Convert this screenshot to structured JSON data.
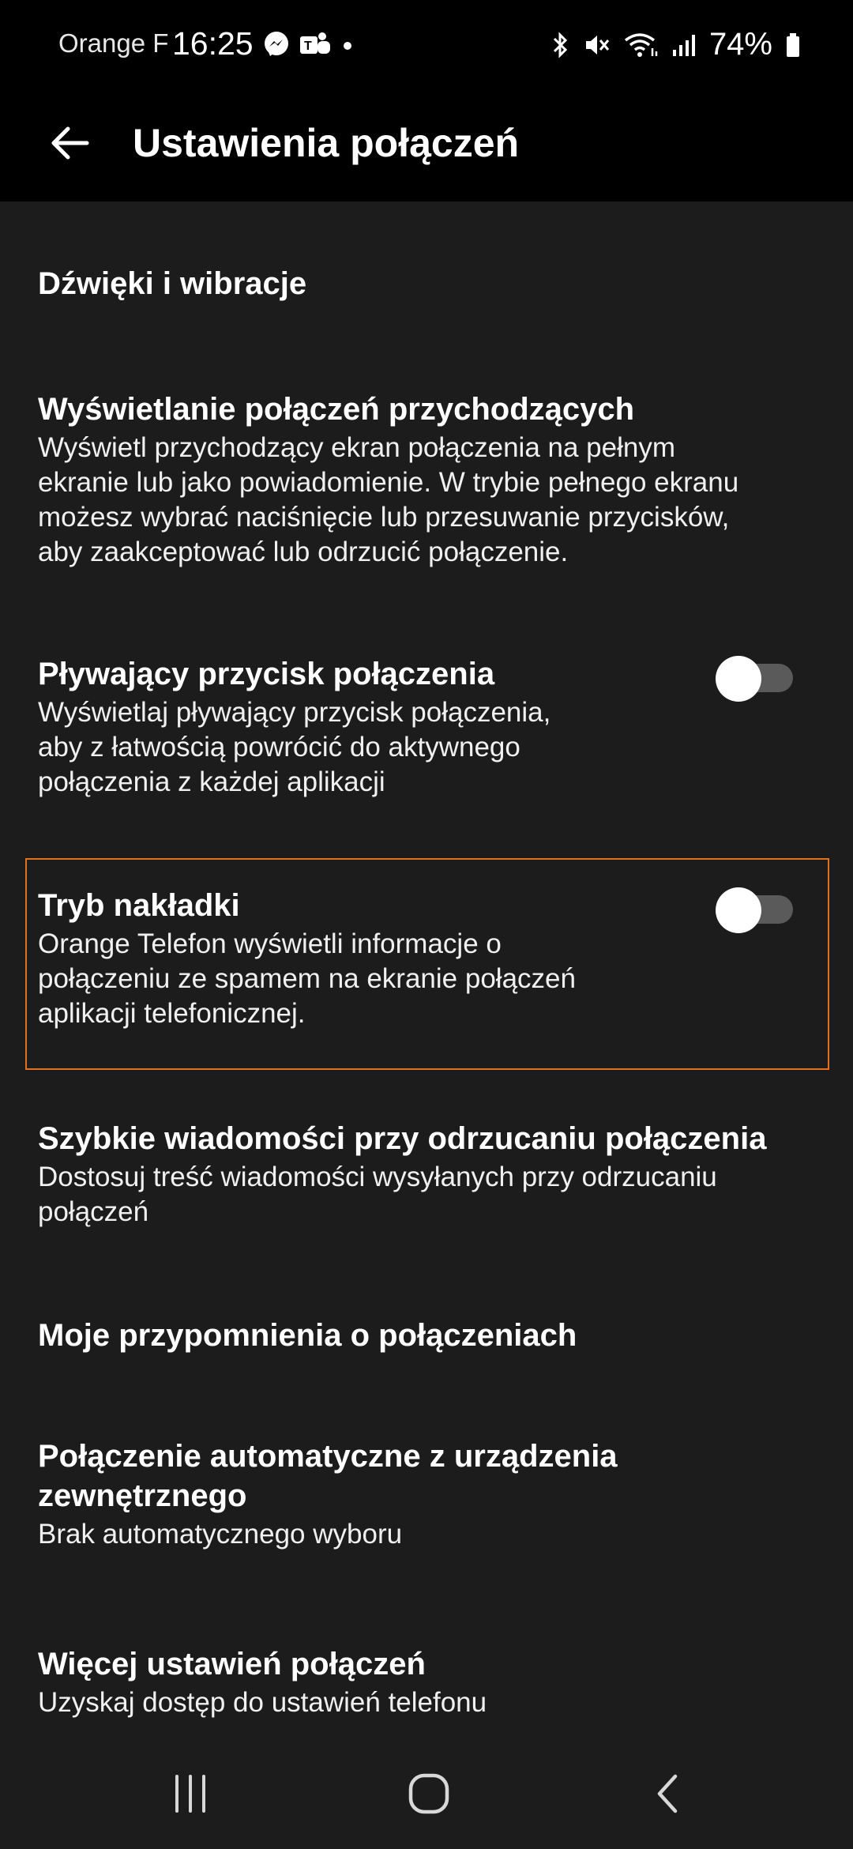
{
  "status_bar": {
    "carrier": "Orange F",
    "time": "16:25",
    "left_icons": [
      "messenger-icon",
      "teams-icon",
      "dot-icon"
    ],
    "right_icons": [
      "bluetooth-icon",
      "mute-icon",
      "wifi-icon",
      "signal-icon",
      "battery-icon"
    ],
    "battery": "74%"
  },
  "app_bar": {
    "title": "Ustawienia połączeń",
    "back_icon": "arrow-left-icon"
  },
  "settings": [
    {
      "title": "Dźwięki i wibracje"
    },
    {
      "title": "Wyświetlanie połączeń przychodzących",
      "desc": [
        "Wyświetl przychodzący ekran połączenia na pełnym",
        "ekranie lub jako powiadomienie. W trybie pełnego ekranu",
        "możesz wybrać naciśnięcie lub przesuwanie przycisków,",
        "aby zaakceptować lub odrzucić połączenie."
      ]
    },
    {
      "title": "Pływający przycisk połączenia",
      "desc": [
        "Wyświetlaj pływający przycisk połączenia,",
        "aby z łatwością powrócić do aktywnego",
        "połączenia z każdej aplikacji"
      ],
      "toggle": "off"
    },
    {
      "title": "Tryb nakładki",
      "desc": [
        "Orange Telefon wyświetli informacje o",
        "połączeniu ze spamem na ekranie połączeń",
        "aplikacji telefonicznej."
      ],
      "toggle": "off"
    },
    {
      "title": "Szybkie wiadomości przy odrzucaniu połączenia",
      "desc": [
        "Dostosuj treść wiadomości wysyłanych przy odrzucaniu",
        "połączeń"
      ]
    },
    {
      "title": "Moje przypomnienia o połączeniach"
    },
    {
      "title": [
        "Połączenie automatyczne z urządzenia",
        "zewnętrznego"
      ],
      "desc": [
        "Brak automatycznego wyboru"
      ]
    },
    {
      "title": "Więcej ustawień połączeń",
      "desc": [
        "Uzyskaj dostęp do ustawień telefonu"
      ]
    }
  ],
  "highlight_color": "#e3701f",
  "nav_bar": {
    "buttons": [
      "recent-apps-icon",
      "home-icon",
      "back-icon"
    ]
  }
}
